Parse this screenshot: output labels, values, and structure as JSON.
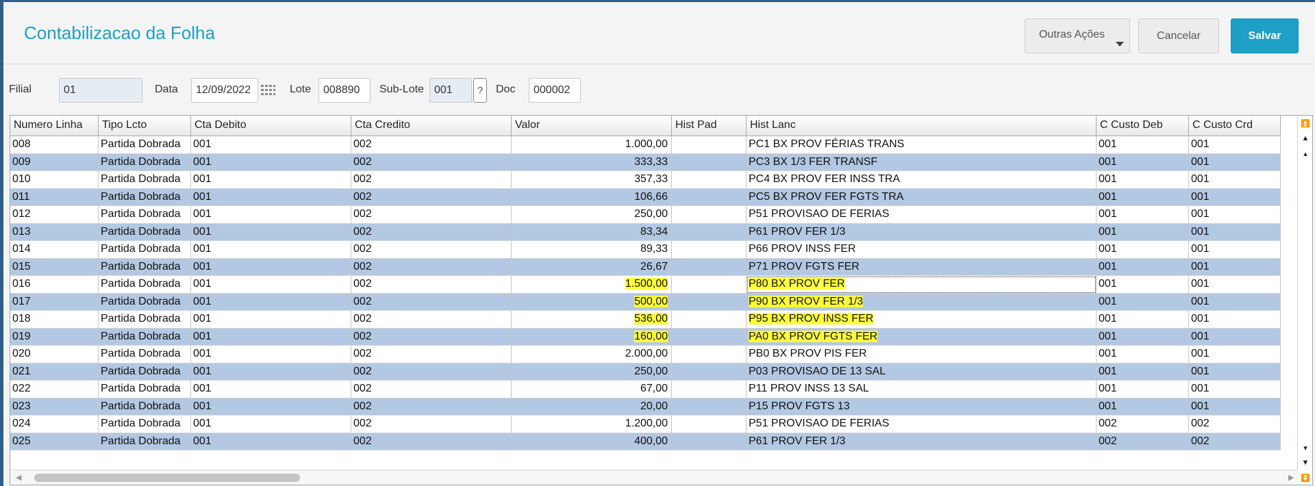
{
  "header": {
    "title": "Contabilizacao da Folha",
    "outras_label": "Outras Ações",
    "cancelar_label": "Cancelar",
    "salvar_label": "Salvar"
  },
  "form": {
    "filial_label": "Filial",
    "filial_value": "01",
    "data_label": "Data",
    "data_value": "12/09/2022",
    "lote_label": "Lote",
    "lote_value": "008890",
    "sublote_label": "Sub-Lote",
    "sublote_value": "001",
    "help_label": "?",
    "doc_label": "Doc",
    "doc_value": "000002"
  },
  "grid": {
    "columns": [
      "Numero Linha",
      "Tipo Lcto",
      "Cta Debito",
      "Cta Credito",
      "Valor",
      "Hist Pad",
      "Hist Lanc",
      "C Custo Deb",
      "C Custo Crd"
    ],
    "rows": [
      [
        "008",
        "Partida Dobrada",
        "001",
        "002",
        "1.000,00",
        "",
        "PC1 BX PROV FÉRIAS TRANS",
        "001",
        "001"
      ],
      [
        "009",
        "Partida Dobrada",
        "001",
        "002",
        "333,33",
        "",
        "PC3 BX 1/3 FER TRANSF",
        "001",
        "001"
      ],
      [
        "010",
        "Partida Dobrada",
        "001",
        "002",
        "357,33",
        "",
        "PC4 BX PROV FER INSS TRA",
        "001",
        "001"
      ],
      [
        "011",
        "Partida Dobrada",
        "001",
        "002",
        "106,66",
        "",
        "PC5 BX PROV FER FGTS TRA",
        "001",
        "001"
      ],
      [
        "012",
        "Partida Dobrada",
        "001",
        "002",
        "250,00",
        "",
        "P51 PROVISAO DE FERIAS",
        "001",
        "001"
      ],
      [
        "013",
        "Partida Dobrada",
        "001",
        "002",
        "83,34",
        "",
        "P61 PROV FER 1/3",
        "001",
        "001"
      ],
      [
        "014",
        "Partida Dobrada",
        "001",
        "002",
        "89,33",
        "",
        "P66 PROV INSS FER",
        "001",
        "001"
      ],
      [
        "015",
        "Partida Dobrada",
        "001",
        "002",
        "26,67",
        "",
        "P71 PROV FGTS FER",
        "001",
        "001"
      ],
      [
        "016",
        "Partida Dobrada",
        "001",
        "002",
        "1.500,00",
        "",
        "P80 BX PROV FER",
        "001",
        "001"
      ],
      [
        "017",
        "Partida Dobrada",
        "001",
        "002",
        "500,00",
        "",
        "P90 BX PROV FER 1/3",
        "001",
        "001"
      ],
      [
        "018",
        "Partida Dobrada",
        "001",
        "002",
        "536,00",
        "",
        "P95 BX PROV INSS FER",
        "001",
        "001"
      ],
      [
        "019",
        "Partida Dobrada",
        "001",
        "002",
        "160,00",
        "",
        "PA0 BX PROV FGTS FER",
        "001",
        "001"
      ],
      [
        "020",
        "Partida Dobrada",
        "001",
        "002",
        "2.000,00",
        "",
        "PB0 BX PROV PIS FER",
        "001",
        "001"
      ],
      [
        "021",
        "Partida Dobrada",
        "001",
        "002",
        "250,00",
        "",
        "P03 PROVISAO DE 13 SAL",
        "001",
        "001"
      ],
      [
        "022",
        "Partida Dobrada",
        "001",
        "002",
        "67,00",
        "",
        "P11 PROV INSS 13  SAL",
        "001",
        "001"
      ],
      [
        "023",
        "Partida Dobrada",
        "001",
        "002",
        "20,00",
        "",
        "P15 PROV FGTS 13",
        "001",
        "001"
      ],
      [
        "024",
        "Partida Dobrada",
        "001",
        "002",
        "1.200,00",
        "",
        "P51 PROVISAO DE FERIAS",
        "002",
        "002"
      ],
      [
        "025",
        "Partida Dobrada",
        "001",
        "002",
        "400,00",
        "",
        "P61 PROV FER 1/3",
        "002",
        "002"
      ]
    ],
    "highlighted_rows": [
      "016",
      "017",
      "018",
      "019"
    ],
    "selected_cell": "016 Hist Lanc"
  },
  "colors": {
    "title": "#1e9fc6",
    "salvar_bg": "#1e9fc6",
    "alt_row": "#b3c8e2",
    "highlight": "#ffff3a"
  },
  "icons": [
    "calendar-icon",
    "scroll-top-icon",
    "page-up-icon",
    "scroll-up-icon",
    "scroll-down-icon",
    "page-down-icon",
    "scroll-bottom-icon",
    "scroll-left-icon",
    "scroll-right-icon",
    "dropdown-caret-icon"
  ]
}
